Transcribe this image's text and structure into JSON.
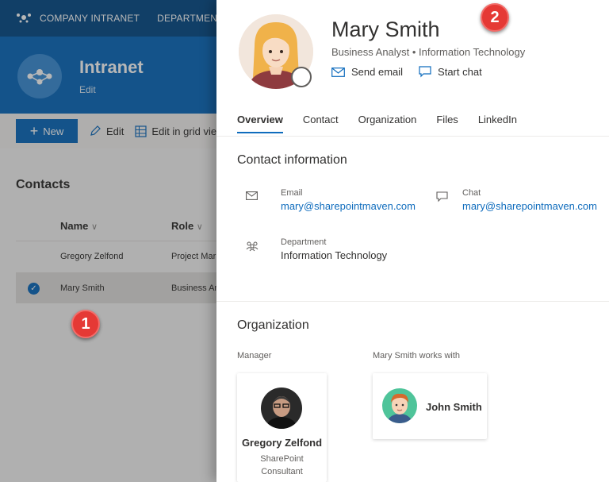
{
  "background": {
    "suitebar": {
      "items": [
        "COMPANY INTRANET",
        "DEPARTMENT"
      ]
    },
    "site": {
      "title": "Intranet",
      "subtitle": "Edit"
    },
    "commandbar": {
      "new_label": "New",
      "edit_label": "Edit",
      "grid_label": "Edit in grid vie"
    },
    "list": {
      "title": "Contacts",
      "columns": [
        "Name",
        "Role"
      ],
      "rows": [
        {
          "name": "Gregory Zelfond",
          "role": "Project Mar",
          "selected": false
        },
        {
          "name": "Mary Smith",
          "role": "Business An",
          "selected": true
        }
      ]
    }
  },
  "badges": {
    "one": "1",
    "two": "2"
  },
  "profile": {
    "name": "Mary Smith",
    "subtitle": "Business Analyst • Information Technology",
    "actions": {
      "email": "Send email",
      "chat": "Start chat"
    },
    "tabs": [
      "Overview",
      "Contact",
      "Organization",
      "Files",
      "LinkedIn"
    ],
    "active_tab": "Overview",
    "contact": {
      "title": "Contact information",
      "email_label": "Email",
      "email_value": "mary@sharepointmaven.com",
      "chat_label": "Chat",
      "chat_value": "mary@sharepointmaven.com",
      "dept_label": "Department",
      "dept_value": "Information Technology"
    },
    "organization": {
      "title": "Organization",
      "manager_label": "Manager",
      "manager_name": "Gregory Zelfond",
      "manager_role_line1": "SharePoint",
      "manager_role_line2": "Consultant",
      "works_with_label": "Mary Smith works with",
      "colleague_name": "John Smith"
    }
  },
  "colors": {
    "accent": "#0f6cbd",
    "suitebar": "#0b4f8a",
    "badge": "#e53935"
  }
}
